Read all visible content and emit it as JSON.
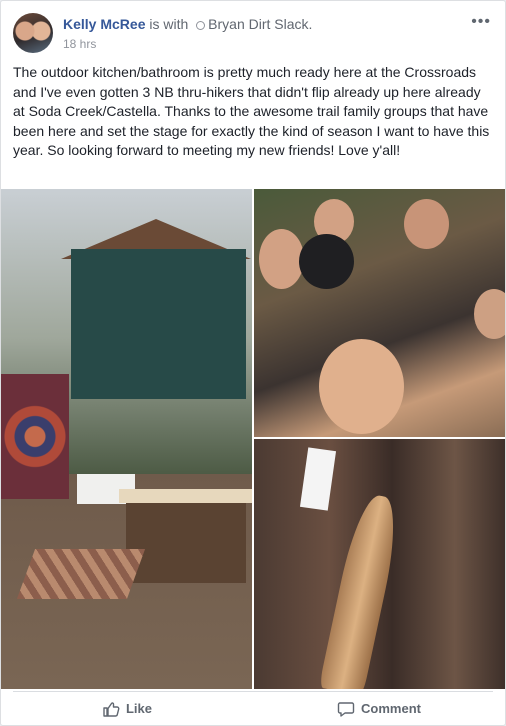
{
  "post": {
    "author": "Kelly McRee",
    "with_text": " is with ",
    "tagged": "Bryan Dirt Slack.",
    "time": "18 hrs",
    "more": "•••",
    "text": "The outdoor kitchen/bathroom is pretty much ready here at the Crossroads and I've even gotten 3 NB thru-hikers that didn't flip already up here already at Soda Creek/Castella. Thanks to the awesome trail family groups that have been here and set the stage for exactly the kind of season I want to have this year. So looking forward to meeting my new friends! Love y'all!"
  },
  "actions": {
    "like": "Like",
    "comment": "Comment"
  },
  "icons": {
    "like": "thumbs-up-icon",
    "comment": "speech-bubble-icon",
    "tag": "friend-tag-icon",
    "more": "ellipsis-icon"
  },
  "colors": {
    "link": "#365899",
    "text": "#1d2129",
    "meta": "#90949c"
  }
}
